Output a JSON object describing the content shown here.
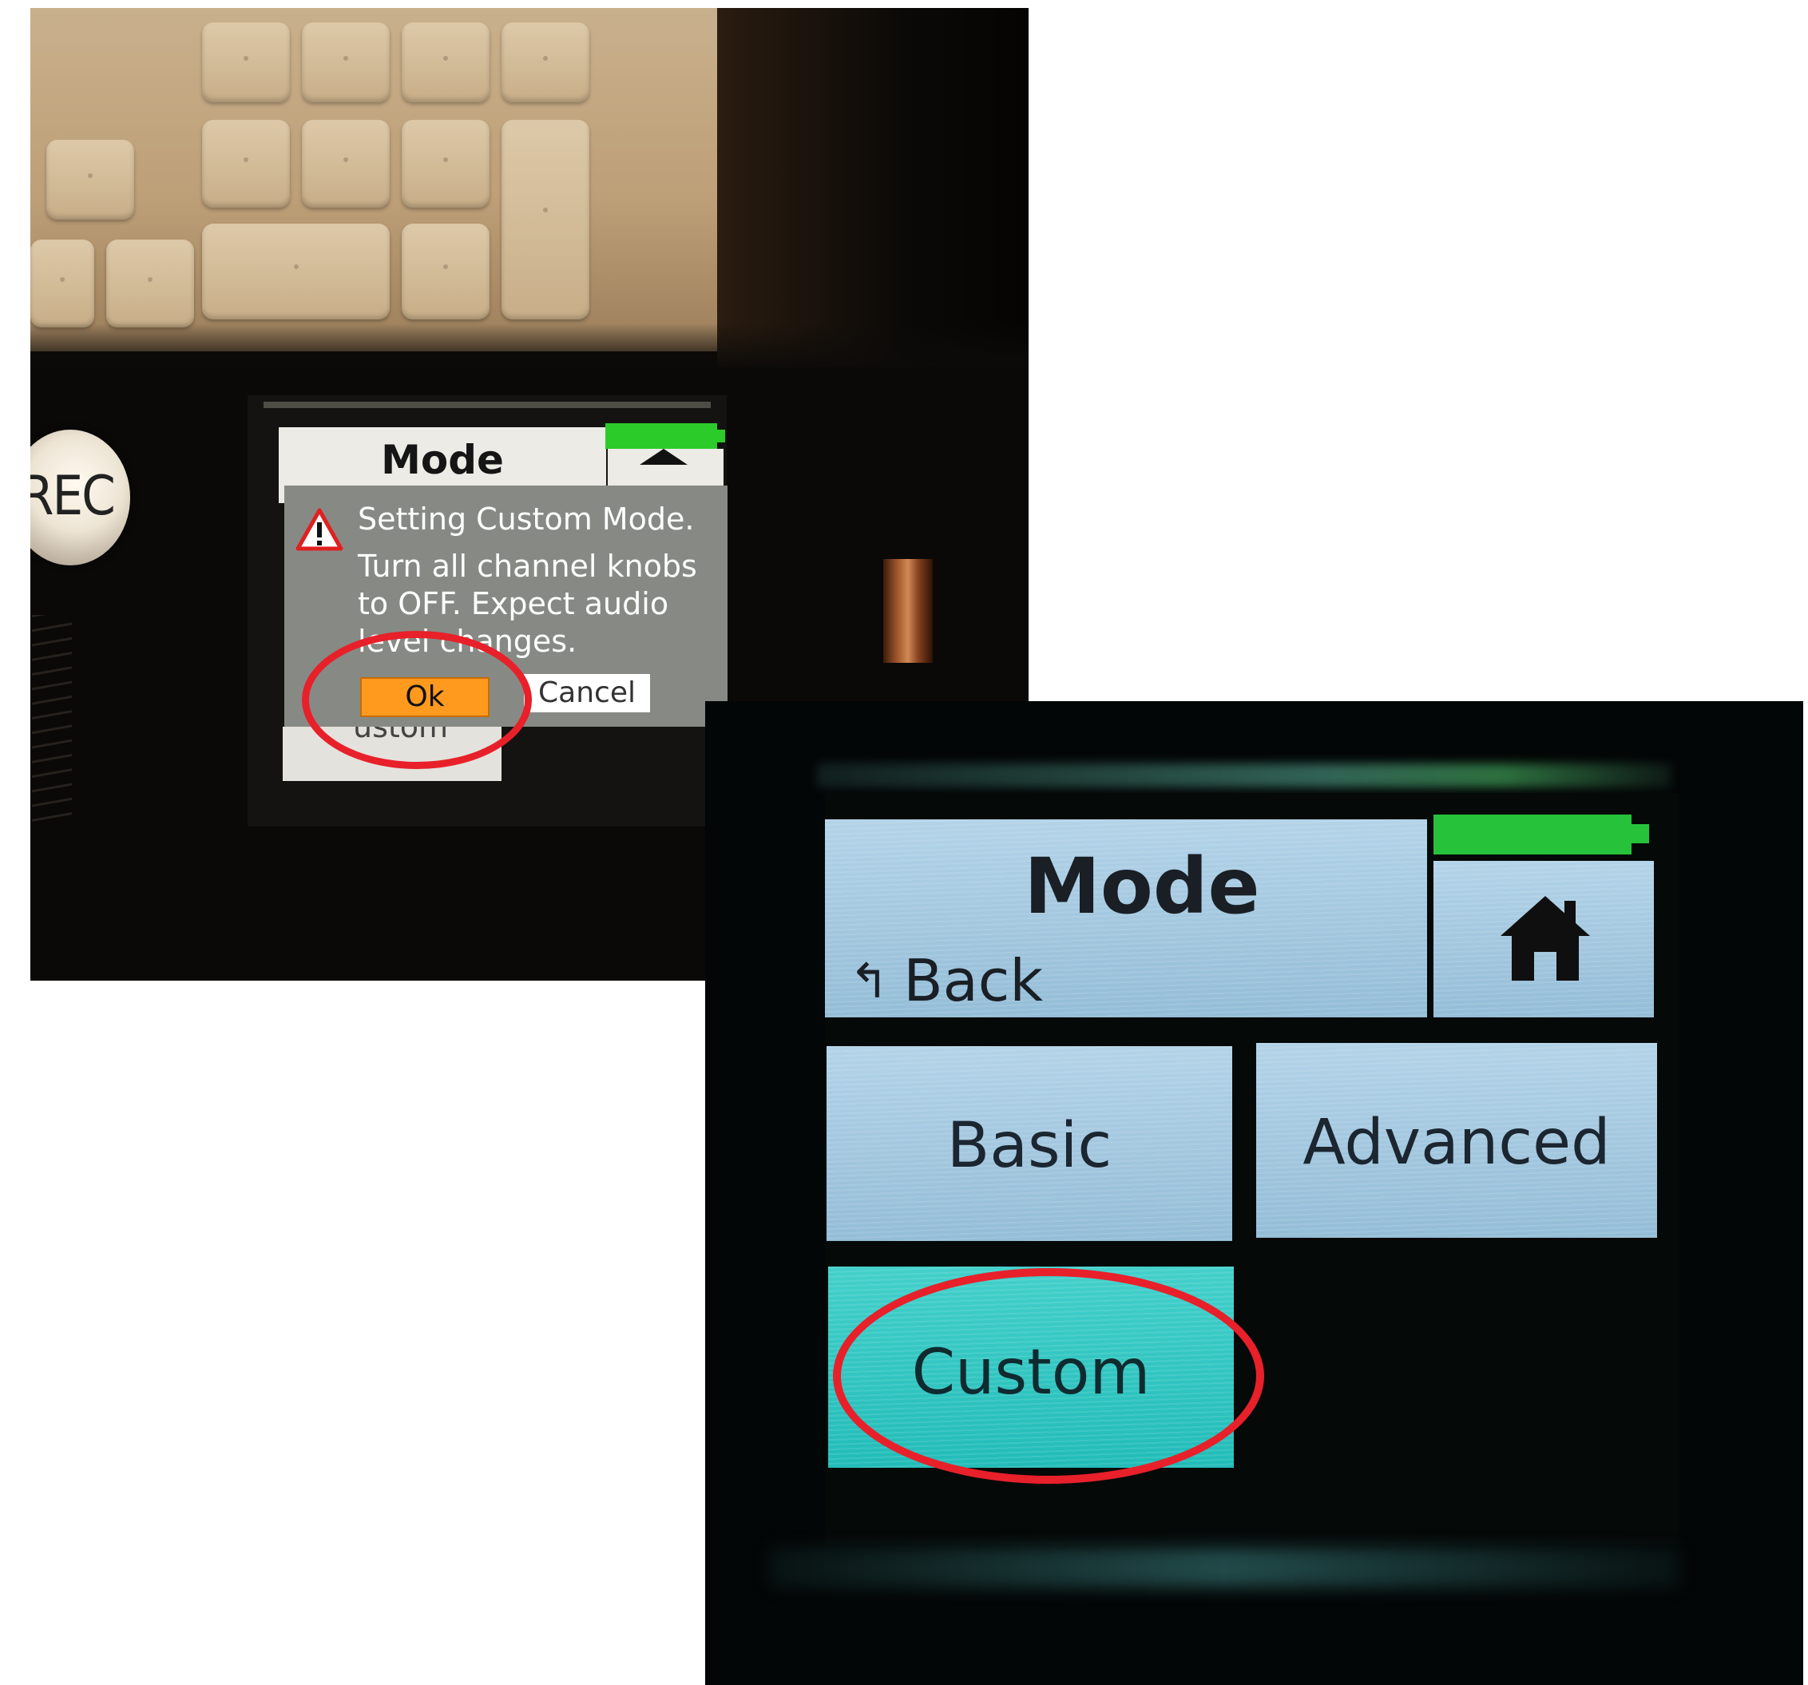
{
  "photo_top_left": {
    "device_button": "REC",
    "screen": {
      "title": "Mode",
      "dialog": {
        "icon": "warning-triangle-icon",
        "message_line1": "Setting Custom Mode.",
        "message_body": "Turn all channel knobs to OFF. Expect audio level changes.",
        "ok_label": "Ok",
        "cancel_label": "Cancel"
      },
      "obscured_item": "ustom"
    },
    "highlight_color": "#e8202a",
    "ok_button_color": "#ff9a1f"
  },
  "photo_bottom_right": {
    "screen": {
      "title": "Mode",
      "back_label": "Back",
      "home_icon": "home-icon",
      "battery_color": "#26c23a",
      "modes": [
        {
          "label": "Basic"
        },
        {
          "label": "Advanced"
        },
        {
          "label": "Custom",
          "selected": true
        }
      ]
    },
    "highlight_color": "#e8202a",
    "selected_tile_color": "#2ec6c1"
  }
}
